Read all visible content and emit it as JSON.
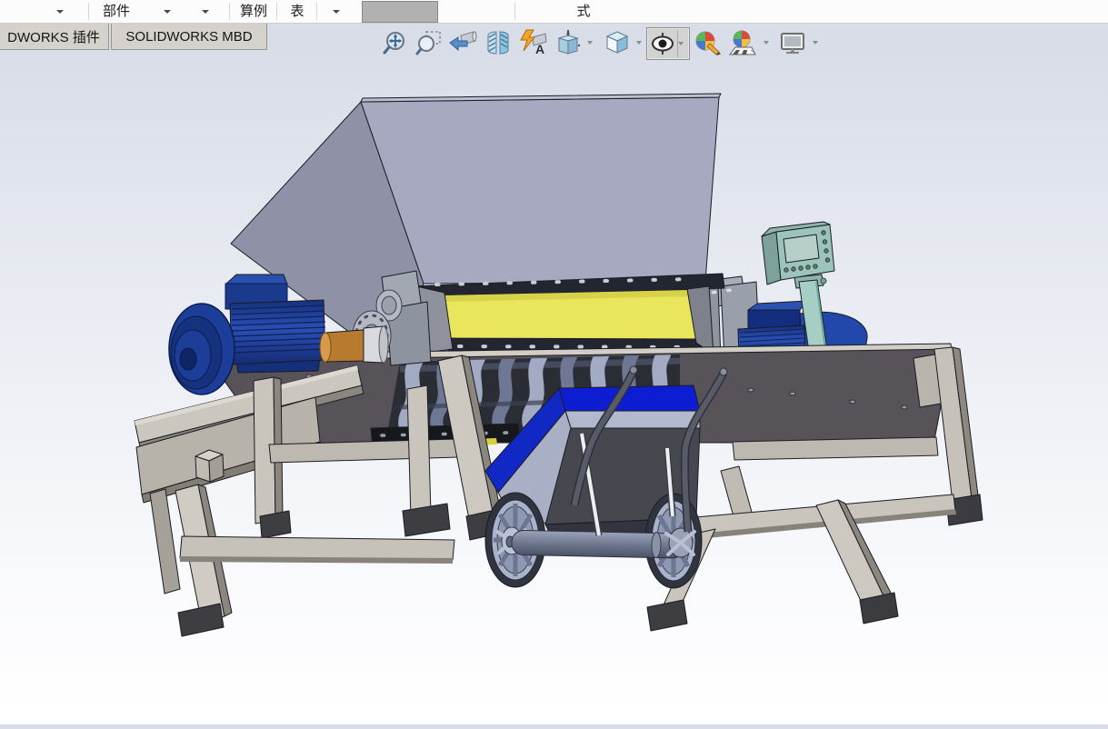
{
  "menubar": {
    "items": {
      "part": "部件",
      "study": "算例",
      "table": "表",
      "expression": "式"
    }
  },
  "tab_bar": {
    "plugins_tab": "DWORKS 插件",
    "mbd_tab": "SOLIDWORKS MBD"
  },
  "toolbar": {
    "buttons": [
      {
        "id": "zoom-to-fit",
        "dropdown": false,
        "pressed": false
      },
      {
        "id": "zoom-to-area",
        "dropdown": false,
        "pressed": false
      },
      {
        "id": "previous-view",
        "dropdown": false,
        "pressed": false
      },
      {
        "id": "section-view",
        "dropdown": false,
        "pressed": false
      },
      {
        "id": "dynamic-annotation-views",
        "dropdown": false,
        "pressed": false
      },
      {
        "id": "zoom-to-selection",
        "dropdown": true,
        "pressed": false
      },
      {
        "id": "view-orientation",
        "dropdown": true,
        "pressed": false
      },
      {
        "id": "display-style",
        "dropdown": true,
        "pressed": true
      },
      {
        "id": "edit-appearance",
        "dropdown": false,
        "pressed": false
      },
      {
        "id": "apply-scene",
        "dropdown": true,
        "pressed": false
      },
      {
        "id": "view-settings",
        "dropdown": true,
        "pressed": false
      }
    ]
  },
  "viewport": {
    "content": "3D CAD assembly of a dual-shaft shredder machine with feed hopper, two drive motors, control pendant, support frame and wheeled discharge cart",
    "colors": {
      "hopper": "#a6a9c0",
      "chamber_liner": "#e9e65e",
      "motor_blue": "#1d3e98",
      "coupling_orange": "#b87a2e",
      "control_panel_teal": "#9dc4bb",
      "frame_tan": "#cbc7be",
      "deck_dark": "#585359",
      "cart_accent_blue": "#0d1ed2",
      "cart_body": "#a9b0c5",
      "background_top": "#d9dde8",
      "background_bottom": "#ffffff"
    }
  }
}
